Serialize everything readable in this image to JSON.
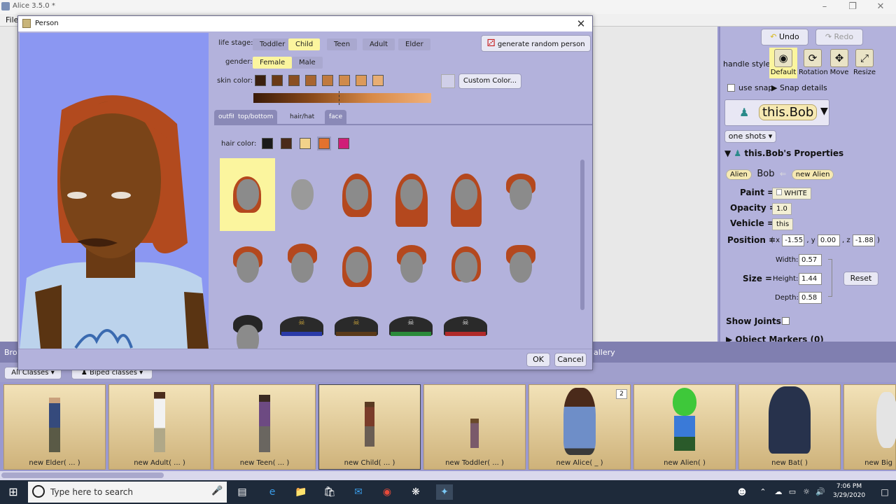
{
  "app": {
    "title": "Alice 3.5.0 *",
    "menu_file": "File"
  },
  "dialog": {
    "title": "Person",
    "life_stage_label": "life stage:",
    "life_stages": [
      "Toddler",
      "Child",
      "Teen",
      "Adult",
      "Elder"
    ],
    "life_stage_selected": "Child",
    "gender_label": "gender:",
    "genders": [
      "Female",
      "Male"
    ],
    "gender_selected": "Female",
    "skin_color_label": "skin color:",
    "skin_swatches": [
      "#3a2010",
      "#6a3a16",
      "#8a4f22",
      "#a86530",
      "#c07a3e",
      "#d08a4a",
      "#dc9a5a",
      "#e8ae74"
    ],
    "custom_color_button": "Custom Color...",
    "random_button": "generate random person",
    "tabs": [
      "outfit",
      "top/bottom",
      "hair/hat",
      "face"
    ],
    "tab_selected": "hair/hat",
    "hair_color_label": "hair color:",
    "hair_swatches": [
      "#1a1a1a",
      "#4a2a18",
      "#f2d28a",
      "#e2722e",
      "#d01e78"
    ],
    "ok_button": "OK",
    "cancel_button": "Cancel"
  },
  "right_panel": {
    "undo": "Undo",
    "redo": "Redo",
    "handle_style_label": "handle style:",
    "handle_styles": [
      "Default",
      "Rotation",
      "Move",
      "Resize"
    ],
    "use_snap": "use snap",
    "snap_details": "Snap details",
    "selected_object": "this.Bob",
    "one_shots": "one shots",
    "properties_title": "this.Bob's Properties",
    "class_tag": "Alien",
    "name": "Bob",
    "new_tag": "new",
    "new_class": "Alien",
    "paint_label": "Paint =",
    "paint_value": "WHITE",
    "opacity_label": "Opacity =",
    "opacity_value": "1.0",
    "vehicle_label": "Vehicle =",
    "vehicle_value": "this",
    "position_label": "Position =",
    "pos_x_label": "x",
    "pos_x": "-1.55",
    "pos_y_label": "y",
    "pos_y": "0.00",
    "pos_z_label": "z",
    "pos_z": "-1.88",
    "size_label": "Size =",
    "width_label": "Width:",
    "width": "0.57",
    "height_label": "Height:",
    "height": "1.44",
    "depth_label": "Depth:",
    "depth": "0.58",
    "reset": "Reset",
    "show_joints": "Show Joints:",
    "object_markers": "Object Markers (0)"
  },
  "gallery": {
    "tab_left": "Bro",
    "tab_right": "allery",
    "all_classes": "All Classes",
    "biped_classes": "Biped classes",
    "items": [
      {
        "caption": "new Elder( ... )"
      },
      {
        "caption": "new Adult( ... )"
      },
      {
        "caption": "new Teen( ... )"
      },
      {
        "caption": "new Child( ... )"
      },
      {
        "caption": "new Toddler( ... )"
      },
      {
        "caption": "new Alice( _ )",
        "badge": "2"
      },
      {
        "caption": "new Alien( )"
      },
      {
        "caption": "new Bat( )"
      },
      {
        "caption": "new Big"
      }
    ]
  },
  "taskbar": {
    "search_placeholder": "Type here to search",
    "time": "7:06 PM",
    "date": "3/29/2020"
  }
}
